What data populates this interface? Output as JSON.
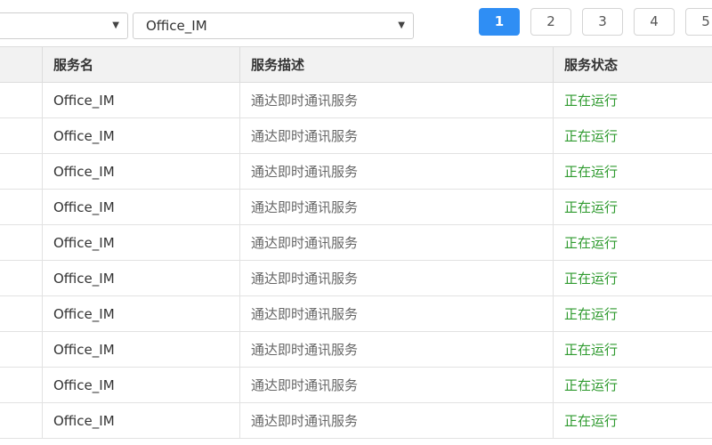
{
  "filters": {
    "first_value": "",
    "second_value": "Office_IM"
  },
  "pagination": {
    "pages": [
      "1",
      "2",
      "3",
      "4",
      "5"
    ],
    "current": "1"
  },
  "table": {
    "columns": [
      "",
      "服务名",
      "服务描述",
      "服务状态"
    ],
    "rows": [
      {
        "name": "Office_IM",
        "description": "通达即时通讯服务",
        "status": "正在运行"
      },
      {
        "name": "Office_IM",
        "description": "通达即时通讯服务",
        "status": "正在运行"
      },
      {
        "name": "Office_IM",
        "description": "通达即时通讯服务",
        "status": "正在运行"
      },
      {
        "name": "Office_IM",
        "description": "通达即时通讯服务",
        "status": "正在运行"
      },
      {
        "name": "Office_IM",
        "description": "通达即时通讯服务",
        "status": "正在运行"
      },
      {
        "name": "Office_IM",
        "description": "通达即时通讯服务",
        "status": "正在运行"
      },
      {
        "name": "Office_IM",
        "description": "通达即时通讯服务",
        "status": "正在运行"
      },
      {
        "name": "Office_IM",
        "description": "通达即时通讯服务",
        "status": "正在运行"
      },
      {
        "name": "Office_IM",
        "description": "通达即时通讯服务",
        "status": "正在运行"
      },
      {
        "name": "Office_IM",
        "description": "通达即时通讯服务",
        "status": "正在运行"
      }
    ]
  },
  "colors": {
    "accent": "#2f8ef4",
    "status_running": "#2e9a2e",
    "header_bg": "#f2f2f2"
  },
  "icons": {
    "select_caret": "chevron-down-icon"
  }
}
